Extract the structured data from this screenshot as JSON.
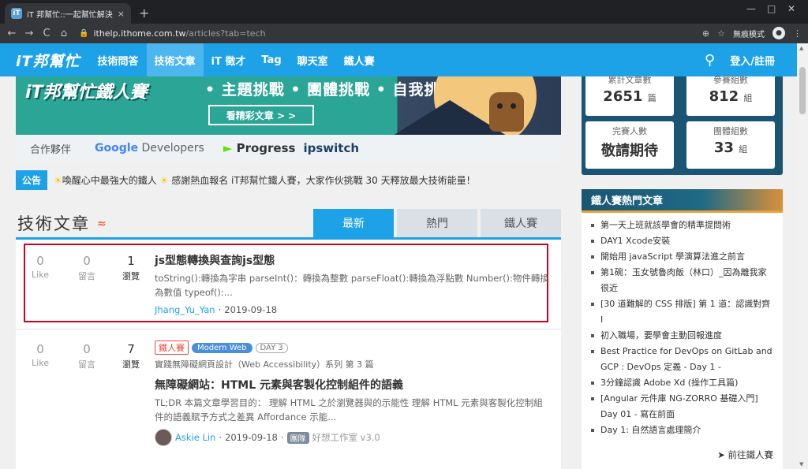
{
  "browser": {
    "tab_title": "iT 邦幫忙::一起幫忙解決難題，拯",
    "tab_close": "×",
    "new_tab": "+",
    "url_domain": "ithelp.ithome.com.tw",
    "url_path": "/articles?tab=tech",
    "incognito_label": "無痕模式",
    "nav_back": "←",
    "nav_forward": "→",
    "nav_reload": "C",
    "nav_home": "⌂",
    "zoom_icon": "⊕",
    "star_icon": "☆",
    "menu_icon": "⋮",
    "win_minimize": "—",
    "win_maximize": "□",
    "win_close": "✕"
  },
  "header": {
    "logo": "iT邦幫忙",
    "nav": [
      "技術問答",
      "技術文章",
      "iT 徵才",
      "Tag",
      "聊天室",
      "鐵人賽"
    ],
    "active_nav": "技術文章",
    "login": "登入/註冊"
  },
  "banner": {
    "logo": "iT邦幫忙鐵人賽",
    "bullets": "• 主題挑戰 • 團體挑戰 • 自我挑戰",
    "cta": "看精彩文章 > >",
    "partners_label": "合作夥伴",
    "partner_google_a": "Google",
    "partner_google_b": " Developers",
    "partner_progress": "Progress",
    "partner_ipswitch": "ipswitch"
  },
  "announcement": {
    "badge": "公告",
    "text_a": "喚醒心中最強大的鐵人",
    "text_b": "感謝熱血報名 iT邦幫忙鐵人賽，大家作伙挑戰 30 天釋放最大技術能量！"
  },
  "section": {
    "title": "技術文章",
    "tabs": [
      "最新",
      "熱門",
      "鐵人賽"
    ],
    "active_tab": "最新"
  },
  "articles": [
    {
      "likes": "0",
      "like_label": "Like",
      "comments": "0",
      "comment_label": "留言",
      "views": "1",
      "view_label": "瀏覽",
      "title": "js型態轉換與查詢js型態",
      "snippet": "toString():轉換為字串 parseInt()：轉換為整數 parseFloat():轉換為浮點數 Number():物件轉換為數值 typeof():...",
      "author": "Jhang_Yu_Yan",
      "date": "2019-09-18"
    },
    {
      "likes": "0",
      "like_label": "Like",
      "comments": "0",
      "comment_label": "留言",
      "views": "7",
      "view_label": "瀏覽",
      "tag_iron": "鐵人賽",
      "tag_topic": "Modern Web",
      "tag_day": "DAY 3",
      "series": "實踐無障礙網頁設計（Web Accessibility）系列 第 3 篇",
      "title": "無障礙網站：HTML 元素與客製化控制組件的語義",
      "snippet": "TL;DR 本篇文章學習目的： 理解 HTML 之於瀏覽器與的示能性 理解 HTML 元素與客製化控制組件的語義賦予方式之差異 Affordance 示能...",
      "author": "Askie Lin",
      "date": "2019-09-18",
      "team_badge": "團隊",
      "team_name": "好想工作室 v3.0"
    }
  ],
  "sidebar": {
    "stats": [
      {
        "label": "累計文章數",
        "value": "2651",
        "unit": "篇"
      },
      {
        "label": "參賽組數",
        "value": "812",
        "unit": "組"
      },
      {
        "label": "完賽人數",
        "value": "敬請期待",
        "unit": ""
      },
      {
        "label": "團體組數",
        "value": "33",
        "unit": "組"
      }
    ],
    "hot_title": "鐵人賽熱門文章",
    "hot_items": [
      "第一天上班就該學會的精準提問術",
      "DAY1 Xcode安裝",
      "開始用 javaScript 學演算法進之前言",
      "第1碗：玉女號魯肉飯（林口）_因為離我家很近",
      "[30 道難解的 CSS 排版] 第 1 道：認識對齊 I",
      "初入職場，要學會主動回報進度",
      "Best Practice for DevOps on GitLab and GCP : DevOps 定義 - Day 1 -",
      "3分鐘認識 Adobe Xd (操作工具篇)",
      "[Angular 元件庫 NG-ZORRO 基礎入門] Day 01 - 寫在前面",
      "Day 1: 自然語言處理簡介"
    ],
    "hot_more": "前往鐵人賽"
  }
}
